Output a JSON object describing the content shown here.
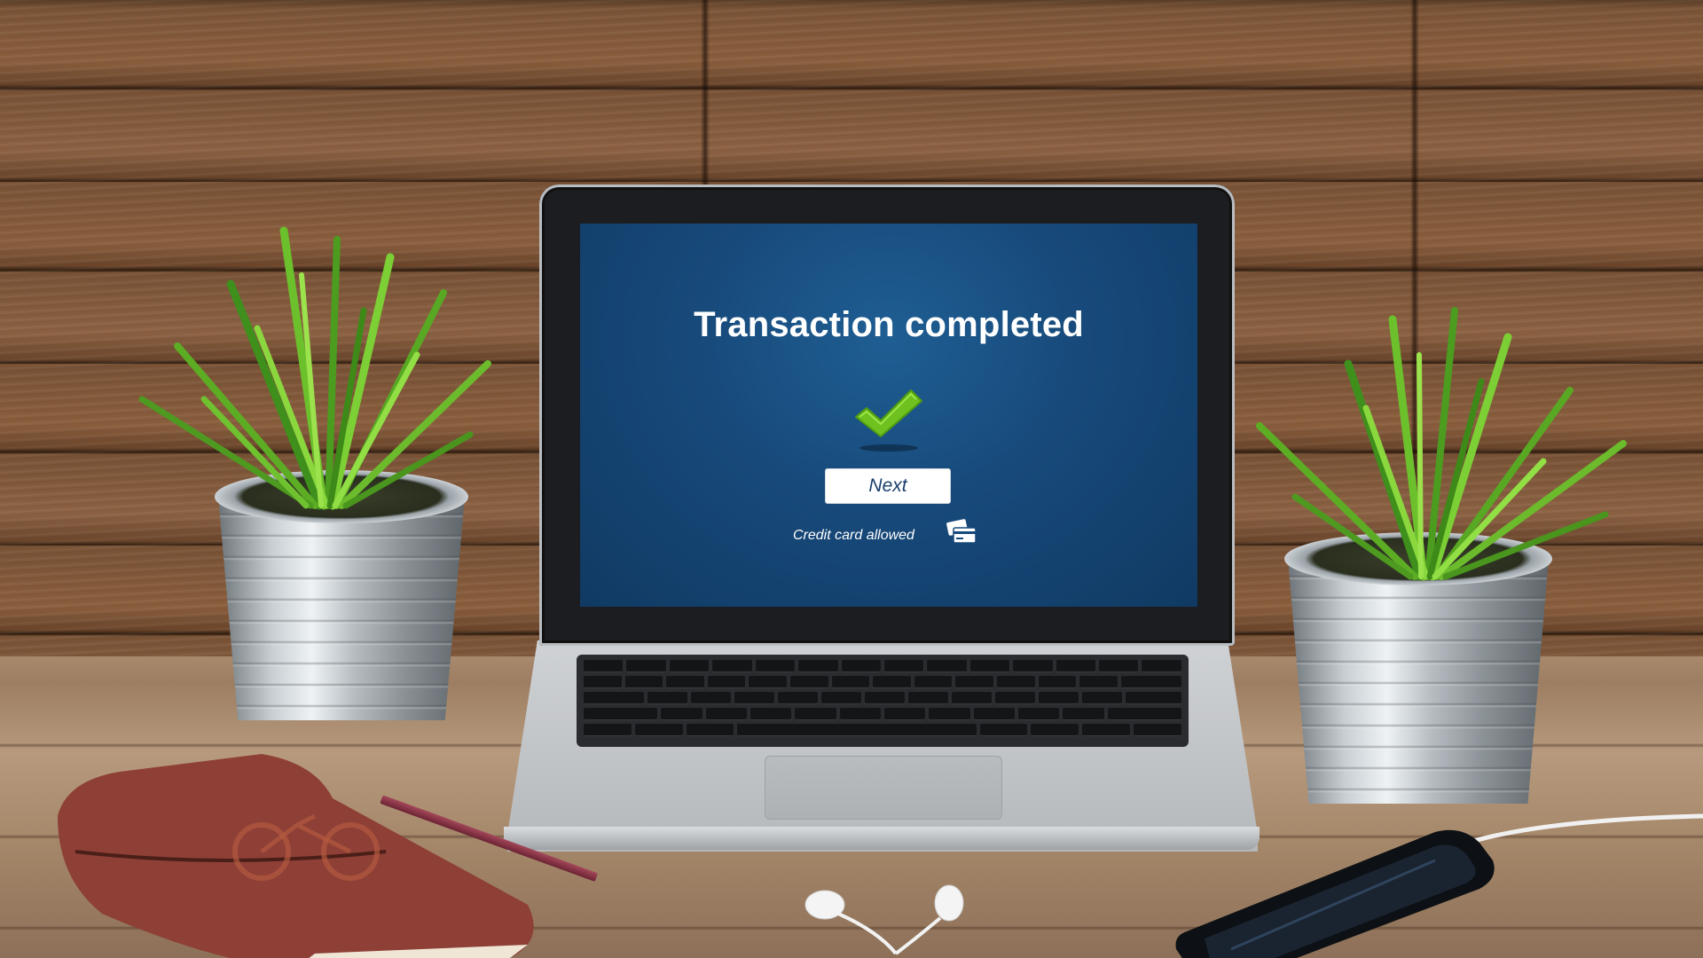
{
  "screen": {
    "title": "Transaction completed",
    "next_button_label": "Next",
    "credit_card_label": "Credit card allowed",
    "check_icon": "checkmark-icon",
    "card_icon": "credit-card-icon"
  },
  "colors": {
    "screen_background": "#17497a",
    "check_green": "#6ec11e",
    "button_text": "#1a3f6d"
  }
}
